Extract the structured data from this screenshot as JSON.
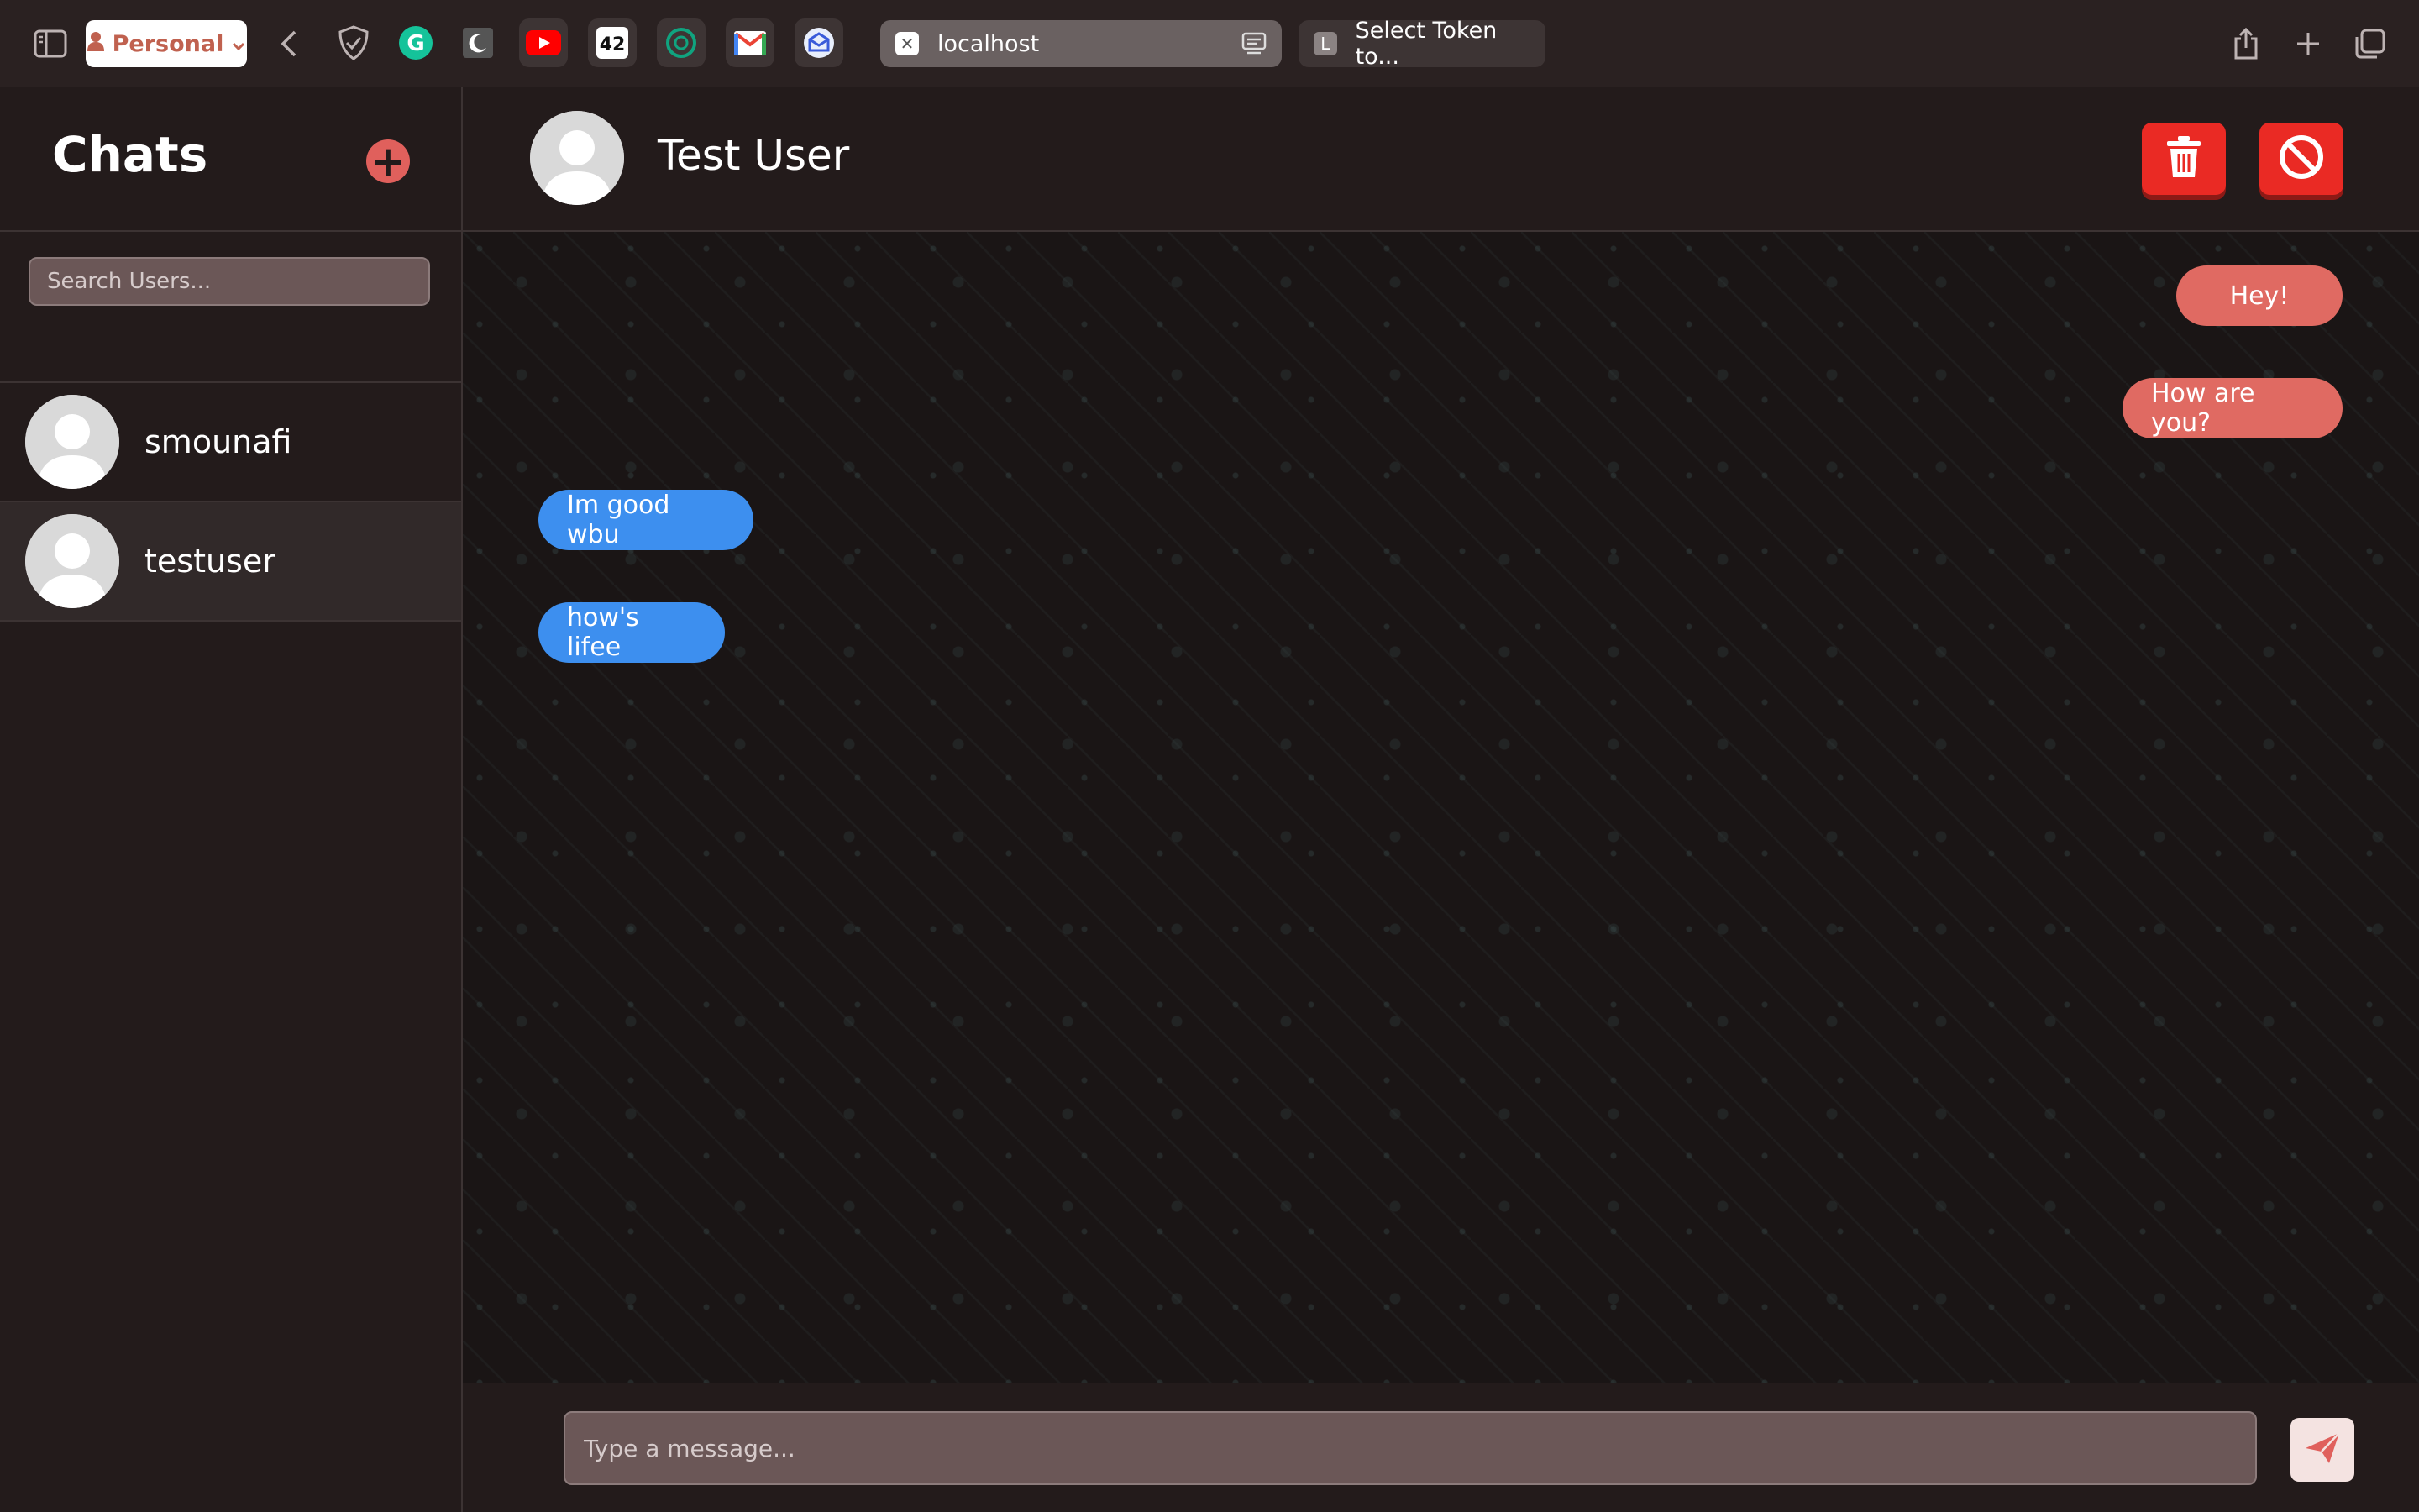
{
  "browser": {
    "profile_label": "Personal",
    "tabs": [
      {
        "title": "localhost",
        "favicon": "x-icon"
      },
      {
        "title": "Select Token to...",
        "favicon": "L"
      }
    ],
    "extensions": [
      "shield-icon",
      "grammarly-icon",
      "night-mode-icon",
      "youtube-icon",
      "42-icon",
      "chatgpt-icon",
      "gmail-icon",
      "mail-extension-icon"
    ]
  },
  "sidebar": {
    "title": "Chats",
    "search_placeholder": "Search Users...",
    "contacts": [
      {
        "name": "smounafi",
        "selected": false
      },
      {
        "name": "testuser",
        "selected": true
      }
    ]
  },
  "chat": {
    "title": "Test User",
    "messages": [
      {
        "text": "Hey!",
        "direction": "sent"
      },
      {
        "text": "How are you?",
        "direction": "sent"
      },
      {
        "text": "Im good wbu",
        "direction": "received"
      },
      {
        "text": "how's lifee",
        "direction": "received"
      }
    ],
    "composer_placeholder": "Type a message..."
  },
  "colors": {
    "accent": "#e0605c",
    "sent_bubble": "#e06a62",
    "received_bubble": "#3d8fef",
    "danger": "#ea2a24",
    "background": "#231b1b"
  }
}
